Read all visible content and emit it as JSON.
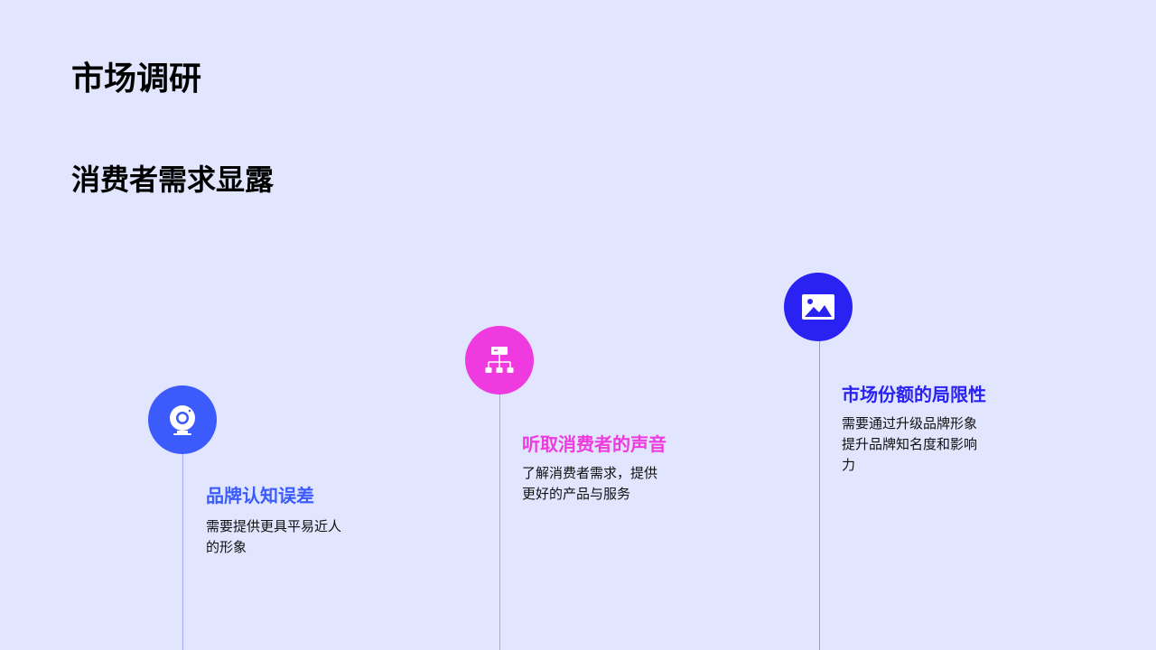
{
  "page": {
    "title": "市场调研",
    "subtitle": "消费者需求显露"
  },
  "items": [
    {
      "icon": "webcam-icon",
      "color": "#3b5bfc",
      "line_color": "#a3acf8",
      "heading": "品牌认知误差",
      "desc_lines": [
        "需要提供更具平易近人",
        "的形象"
      ]
    },
    {
      "icon": "hierarchy-icon",
      "color": "#ee3adf",
      "line_color": "#e58ad8",
      "heading": "听取消费者的声音",
      "desc_lines": [
        "了解消费者需求，提供",
        "更好的产品与服务"
      ]
    },
    {
      "icon": "image-icon",
      "color": "#2a22f2",
      "line_color": "#9a96f2",
      "heading": "市场份额的局限性",
      "desc_lines": [
        "需要通过升级品牌形象",
        "提升品牌知名度和影响",
        "力"
      ]
    }
  ]
}
